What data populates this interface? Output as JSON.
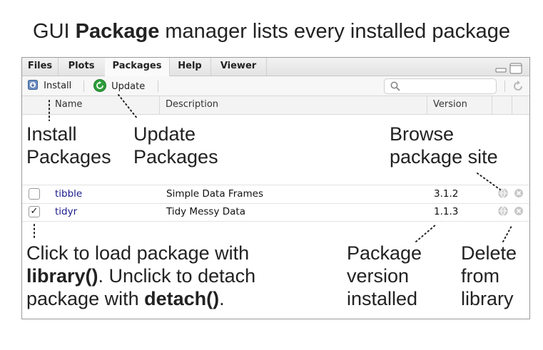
{
  "slide": {
    "title_pre": "GUI ",
    "title_bold": "Package",
    "title_post": " manager lists every installed package"
  },
  "tabs": [
    {
      "label": "Files"
    },
    {
      "label": "Plots"
    },
    {
      "label": "Packages",
      "active": true
    },
    {
      "label": "Help"
    },
    {
      "label": "Viewer"
    }
  ],
  "toolbar": {
    "install_label": "Install",
    "update_label": "Update",
    "search_placeholder": ""
  },
  "columns": {
    "name": "Name",
    "description": "Description",
    "version": "Version"
  },
  "packages": [
    {
      "name": "tibble",
      "description": "Simple Data Frames",
      "version": "3.1.2",
      "loaded": false
    },
    {
      "name": "tidyr",
      "description": "Tidy Messy Data",
      "version": "1.1.3",
      "loaded": true
    }
  ],
  "annotations": {
    "install": [
      "Install",
      "Packages"
    ],
    "update": [
      "Update",
      "Packages"
    ],
    "browse": [
      "Browse",
      "package site"
    ],
    "load_line1": "Click to load package with",
    "load_bold1": "library()",
    "load_mid": ". Unclick to detach",
    "load_line3_pre": "package with ",
    "load_bold2": "detach()",
    "load_end": ".",
    "version": [
      "Package",
      "version",
      "installed"
    ],
    "delete": [
      "Delete",
      "from",
      "library"
    ]
  },
  "colors": {
    "package_link": "#1a1a8c",
    "update_green": "#2e9e3b",
    "install_blue": "#4a6fa5"
  },
  "icons": [
    "install-icon",
    "update-icon",
    "search-icon",
    "refresh-icon",
    "globe-icon",
    "delete-icon",
    "minimize-icon",
    "maximize-icon",
    "checkmark-icon"
  ]
}
